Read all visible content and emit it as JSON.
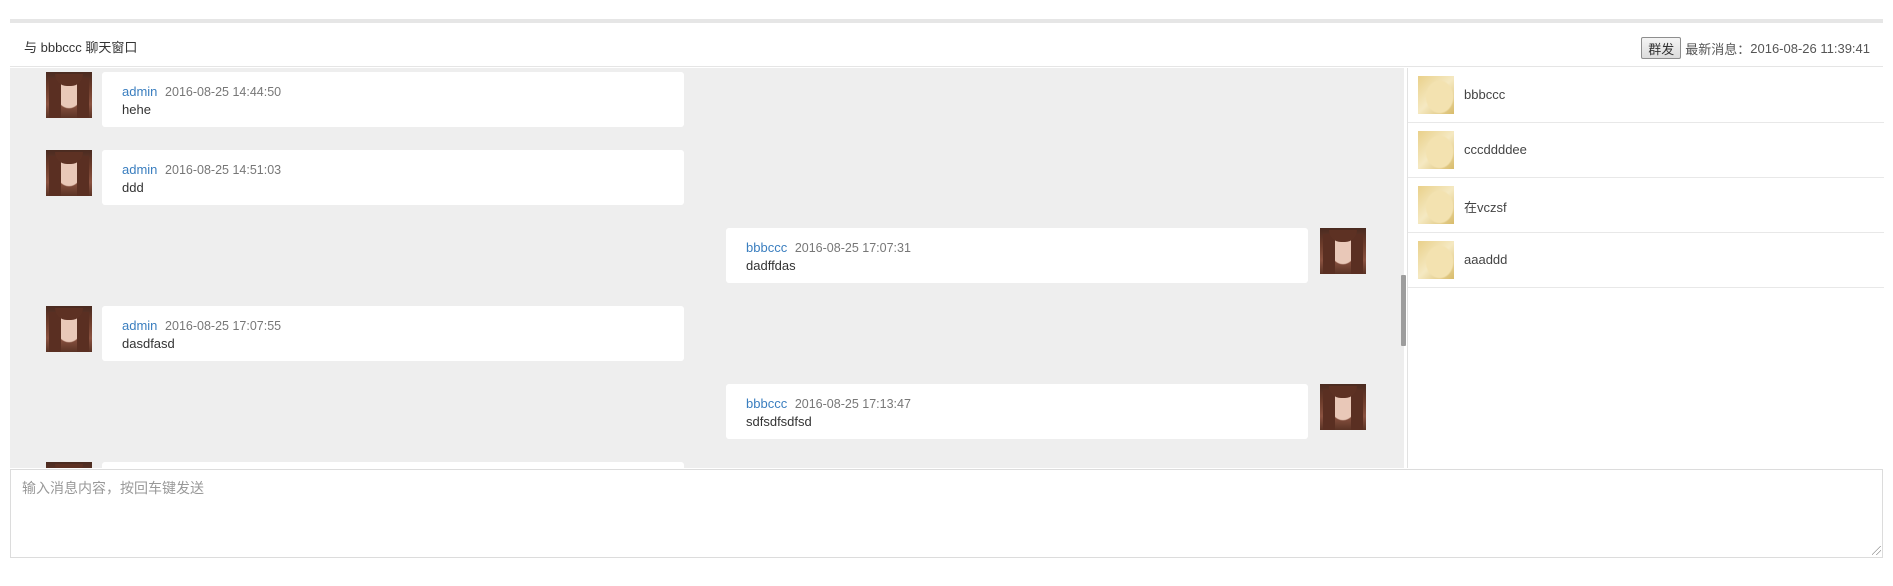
{
  "header": {
    "title": "与 bbbccc 聊天窗口",
    "broadcast_label": "群发",
    "latest_label": "最新消息：",
    "latest_time": "2016-08-26 11:39:41"
  },
  "messages": [
    {
      "side": "left",
      "sender": "admin",
      "time": "2016-08-25 14:44:50",
      "text": "hehe"
    },
    {
      "side": "left",
      "sender": "admin",
      "time": "2016-08-25 14:51:03",
      "text": "ddd"
    },
    {
      "side": "right",
      "sender": "bbbccc",
      "time": "2016-08-25 17:07:31",
      "text": "dadffdas"
    },
    {
      "side": "left",
      "sender": "admin",
      "time": "2016-08-25 17:07:55",
      "text": "dasdfasd"
    },
    {
      "side": "right",
      "sender": "bbbccc",
      "time": "2016-08-25 17:13:47",
      "text": "sdfsdfsdfsd"
    }
  ],
  "users": [
    {
      "name": "bbbccc"
    },
    {
      "name": "cccddddee"
    },
    {
      "name": "在vczsf"
    },
    {
      "name": "aaaddd"
    }
  ],
  "input": {
    "placeholder": "输入消息内容，按回车键发送",
    "value": ""
  },
  "colors": {
    "chat_background": "#eeeeee",
    "sender_link": "#3a7ebf",
    "bubble": "#ffffff"
  }
}
